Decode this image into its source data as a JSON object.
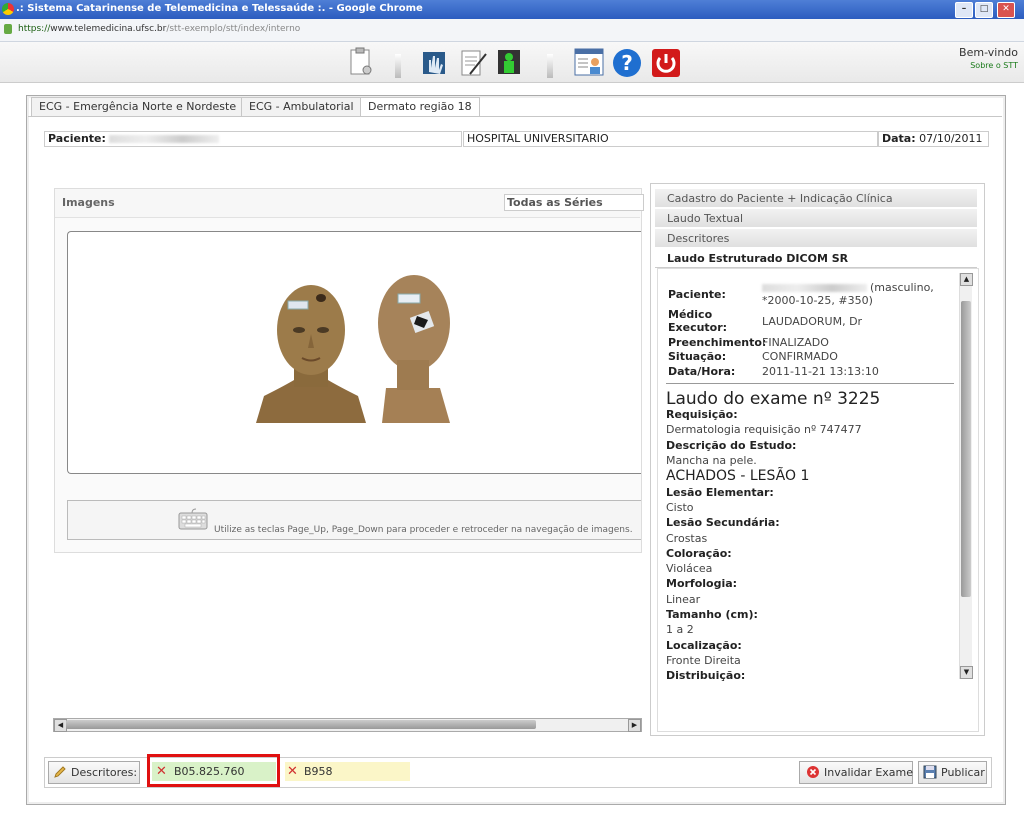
{
  "browser": {
    "title": ".: Sistema Catarinense de Telemedicina e Telessaúde :. - Google Chrome",
    "url_scheme": "https://",
    "url_host": "www.telemedicina.ufsc.br",
    "url_path": "/stt-exemplo/stt/index/interno"
  },
  "toolbar": {
    "icons": [
      "clipboard-icon",
      "hand-xray-icon",
      "document-pen-icon",
      "monitor-body-icon",
      "user-profile-icon",
      "help-icon",
      "power-icon"
    ],
    "welcome": "Bem-vindo",
    "about": "Sobre o STT"
  },
  "tabs": [
    "ECG - Emergência Norte e Nordeste",
    "ECG - Ambulatorial",
    "Dermato região 18"
  ],
  "header": {
    "paciente_label": "Paciente:",
    "hospital": "HOSPITAL UNIVERSITARIO",
    "data_label": "Data:",
    "data_value": "07/10/2011"
  },
  "viewer": {
    "title": "Imagens",
    "series": "Todas as Séries",
    "hint": "Utilize as teclas Page_Up, Page_Down para proceder e retroceder na navegação de imagens."
  },
  "accordion": [
    "Cadastro do Paciente + Indicação Clínica",
    "Laudo Textual",
    "Descritores",
    "Laudo Estruturado DICOM SR"
  ],
  "laudo": {
    "paciente_label": "Paciente:",
    "paciente_value": "(masculino,",
    "paciente_value2": "*2000-10-25, #350)",
    "medico_label1": "Médico",
    "medico_label2": "Executor:",
    "medico_value": "LAUDADORUM, Dr",
    "preench_label": "Preenchimento:",
    "preench_value": "FINALIZADO",
    "situacao_label": "Situação:",
    "situacao_value": "CONFIRMADO",
    "datahora_label": "Data/Hora:",
    "datahora_value": "2011-11-21 13:13:10",
    "title": "Laudo do exame nº 3225",
    "requisicao_label": "Requisição:",
    "requisicao_value": "Dermatologia requisição nº 747477",
    "descricao_label": "Descrição do Estudo:",
    "descricao_value": "Mancha na pele.",
    "achados": "ACHADOS - LESÃO 1",
    "items": [
      {
        "label": "Lesão Elementar:",
        "value": "Cisto"
      },
      {
        "label": "Lesão Secundária:",
        "value": "Crostas"
      },
      {
        "label": "Coloração:",
        "value": "Violácea"
      },
      {
        "label": "Morfologia:",
        "value": "Linear"
      },
      {
        "label": "Tamanho (cm):",
        "value": "1 a 2"
      },
      {
        "label": "Localização:",
        "value": "Fronte Direita"
      },
      {
        "label": "Distribuição:",
        "value": ""
      }
    ]
  },
  "bottom": {
    "descritores_button": "Descritores:",
    "desc1": "B05.825.760",
    "desc2": "B958",
    "invalidar": "Invalidar Exame",
    "publicar": "Publicar"
  },
  "colors": {
    "desc1_bg": "#d9f2c8",
    "desc2_bg": "#fbf6c8",
    "highlight": "#e01010"
  }
}
